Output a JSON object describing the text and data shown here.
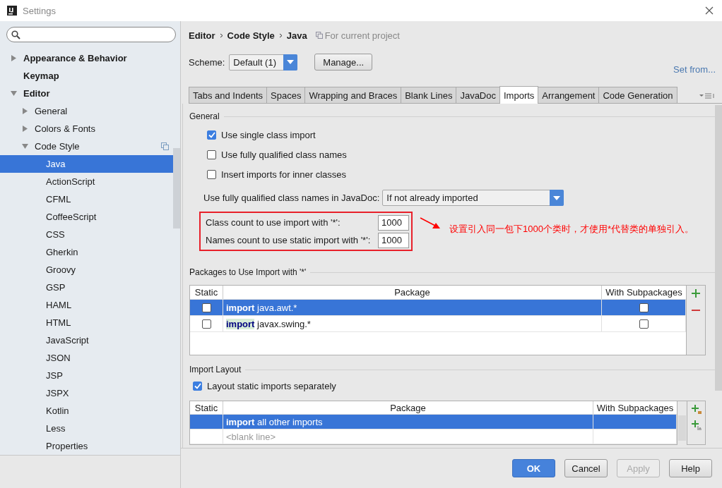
{
  "window": {
    "title": "Settings"
  },
  "sidebar": {
    "tree": [
      {
        "label": "Appearance & Behavior",
        "expanded": false,
        "selected": false
      },
      {
        "label": "Keymap",
        "selected": false
      },
      {
        "label": "Editor",
        "expanded": true,
        "selected": false,
        "children": [
          {
            "label": "General",
            "expanded": false,
            "selected": false
          },
          {
            "label": "Colors & Fonts",
            "expanded": false,
            "selected": false
          },
          {
            "label": "Code Style",
            "expanded": true,
            "selected": false,
            "project_scoped": true,
            "children": [
              {
                "label": "Java",
                "selected": true
              },
              {
                "label": "ActionScript",
                "selected": false
              },
              {
                "label": "CFML",
                "selected": false
              },
              {
                "label": "CoffeeScript",
                "selected": false
              },
              {
                "label": "CSS",
                "selected": false
              },
              {
                "label": "Gherkin",
                "selected": false
              },
              {
                "label": "Groovy",
                "selected": false
              },
              {
                "label": "GSP",
                "selected": false
              },
              {
                "label": "HAML",
                "selected": false
              },
              {
                "label": "HTML",
                "selected": false
              },
              {
                "label": "JavaScript",
                "selected": false
              },
              {
                "label": "JSON",
                "selected": false
              },
              {
                "label": "JSP",
                "selected": false
              },
              {
                "label": "JSPX",
                "selected": false
              },
              {
                "label": "Kotlin",
                "selected": false
              },
              {
                "label": "Less",
                "selected": false
              },
              {
                "label": "Properties",
                "selected": false
              }
            ]
          }
        ]
      }
    ]
  },
  "breadcrumb": [
    "Editor",
    "Code Style",
    "Java"
  ],
  "scope_note": "For current project",
  "scheme": {
    "label": "Scheme:",
    "value": "Default (1)"
  },
  "manage_button": "Manage...",
  "set_from_link": "Set from...",
  "tabs": [
    {
      "label": "Tabs and Indents",
      "selected": false
    },
    {
      "label": "Spaces",
      "selected": false
    },
    {
      "label": "Wrapping and Braces",
      "selected": false
    },
    {
      "label": "Blank Lines",
      "selected": false
    },
    {
      "label": "JavaDoc",
      "selected": false
    },
    {
      "label": "Imports",
      "selected": true
    },
    {
      "label": "Arrangement",
      "selected": false
    },
    {
      "label": "Code Generation",
      "selected": false
    }
  ],
  "general": {
    "title": "General",
    "checkboxes": [
      {
        "label": "Use single class import",
        "checked": true
      },
      {
        "label": "Use fully qualified class names",
        "checked": false
      },
      {
        "label": "Insert imports for inner classes",
        "checked": false
      }
    ],
    "javadoc": {
      "label": "Use fully qualified class names in JavaDoc:",
      "value": "If not already imported"
    },
    "counts": [
      {
        "label": "Class count to use import with '*':",
        "value": "1000"
      },
      {
        "label": "Names count to use static import with '*':",
        "value": "1000"
      }
    ]
  },
  "annotation": "设置引入同一包下1000个类时，才使用*代替类的单独引入。",
  "packages": {
    "title": "Packages to Use Import with '*'",
    "columns": [
      "Static",
      "Package",
      "With Subpackages"
    ],
    "rows": [
      {
        "static": false,
        "keyword": "import",
        "package": "java.awt.*",
        "with_subpackages": false,
        "selected": true
      },
      {
        "static": false,
        "keyword": "import",
        "package": "javax.swing.*",
        "with_subpackages": false,
        "selected": false
      }
    ]
  },
  "import_layout": {
    "title": "Import Layout",
    "checkbox": {
      "label": "Layout static imports separately",
      "checked": true
    },
    "columns": [
      "Static",
      "Package",
      "With Subpackages"
    ],
    "rows": [
      {
        "kind": "entry",
        "keyword": "import",
        "package": "all other imports",
        "selected": true
      },
      {
        "kind": "blank",
        "package": "<blank line>",
        "selected": false
      }
    ]
  },
  "buttons": [
    {
      "label": "OK",
      "kind": "primary",
      "disabled": false
    },
    {
      "label": "Cancel",
      "kind": "normal",
      "disabled": false
    },
    {
      "label": "Apply",
      "kind": "normal",
      "disabled": true
    },
    {
      "label": "Help",
      "kind": "normal",
      "disabled": false
    }
  ]
}
